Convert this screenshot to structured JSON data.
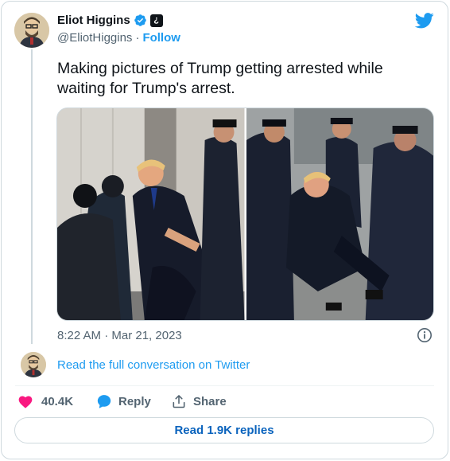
{
  "author": {
    "display_name": "Eliot Higgins",
    "handle": "@EliotHiggins",
    "follow_label": "Follow",
    "verified": true,
    "label_badge": "¿"
  },
  "tweet": {
    "text": "Making pictures of Trump getting arrested while waiting for Trump's arrest.",
    "timestamp": "8:22 AM · Mar 21, 2023"
  },
  "media": [
    {
      "name": "ai-image-1"
    },
    {
      "name": "ai-image-2"
    }
  ],
  "links": {
    "read_conversation": "Read the full conversation on Twitter"
  },
  "actions": {
    "like_count": "40.4K",
    "reply_label": "Reply",
    "share_label": "Share",
    "read_replies_label": "Read 1.9K replies"
  },
  "colors": {
    "accent": "#1d9bf0",
    "like": "#f91880",
    "text_primary": "#0f1419",
    "text_secondary": "#536471"
  },
  "icons": [
    "twitter-bird-icon",
    "verified-badge-icon",
    "info-icon",
    "heart-icon",
    "reply-bubble-icon",
    "share-icon"
  ]
}
